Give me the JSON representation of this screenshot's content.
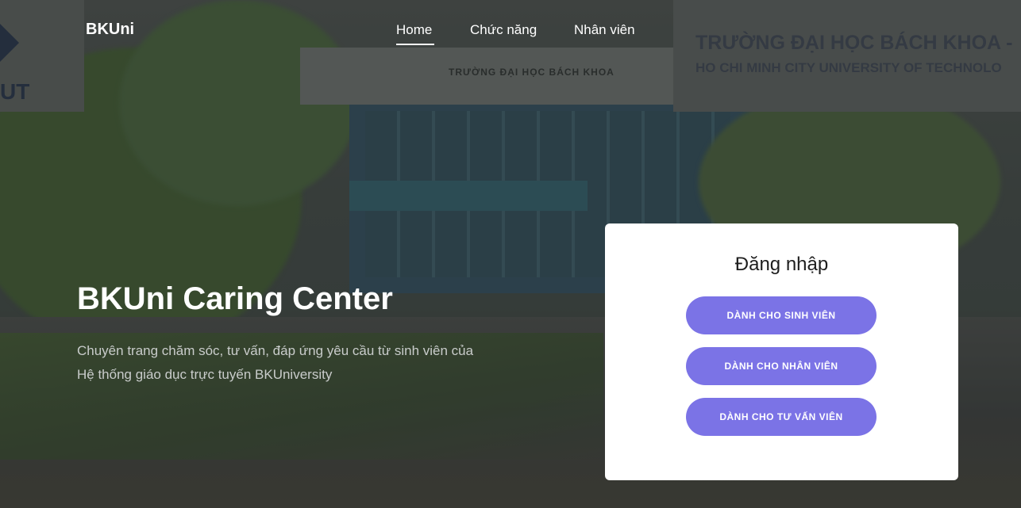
{
  "nav": {
    "brand": "BKUni",
    "links": [
      "Home",
      "Chức năng",
      "Nhân viên"
    ]
  },
  "background": {
    "board_title": "TRƯỜNG ĐẠI HỌC BÁCH KHOA -",
    "board_subtitle": "HO CHI MINH CITY UNIVERSITY OF TECHNOLO",
    "logo_text": "UT",
    "building_sign": "TRƯỜNG ĐẠI HỌC BÁCH KHOA"
  },
  "hero": {
    "title": "BKUni Caring Center",
    "description_line1": "Chuyên trang chăm sóc, tư vấn, đáp ứng yêu cầu từ sinh viên của",
    "description_line2": "Hệ thống giáo dục trực tuyến BKUniversity"
  },
  "login": {
    "title": "Đăng nhập",
    "buttons": [
      "DÀNH CHO SINH VIÊN",
      "DÀNH CHO NHÂN VIÊN",
      "DÀNH CHO TƯ VẤN VIÊN"
    ]
  },
  "colors": {
    "accent": "#7b73e6",
    "card_bg": "#ffffff",
    "text_light": "#ffffff"
  }
}
